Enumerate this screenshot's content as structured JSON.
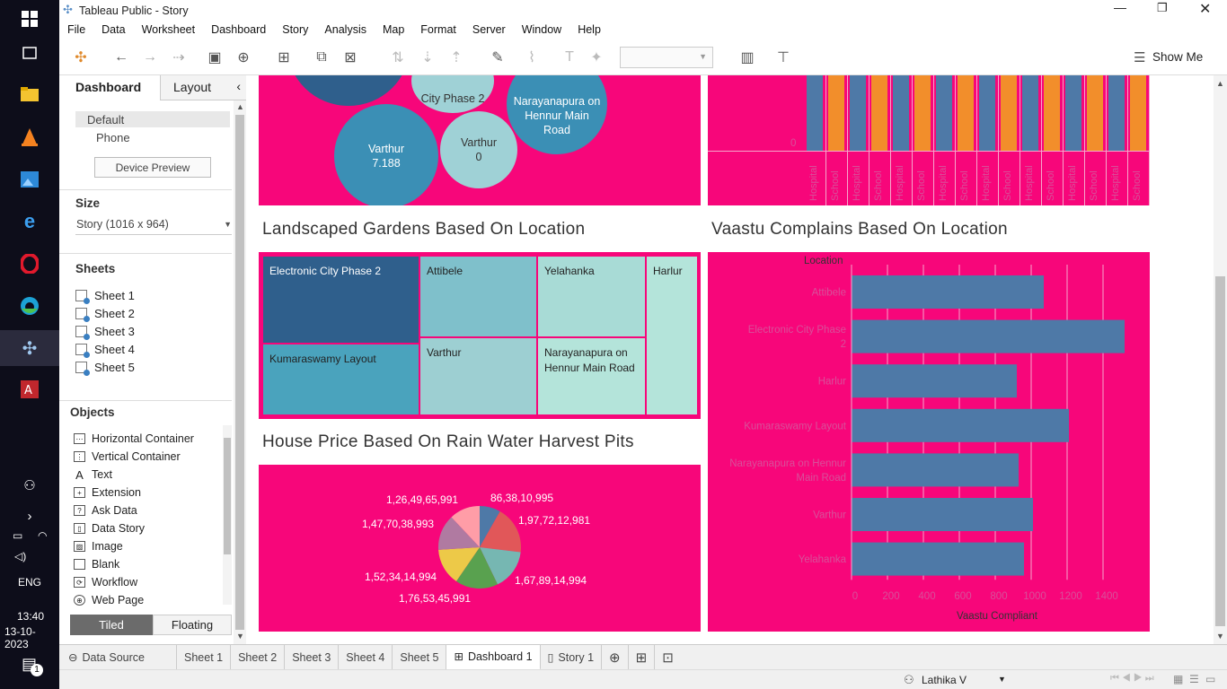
{
  "taskbar": {
    "time": "13:40",
    "date": "13-10-2023",
    "lang": "ENG",
    "notification_count": "1"
  },
  "window": {
    "title": "Tableau Public - Story",
    "icon": "tableau-logo-icon"
  },
  "menu": [
    "File",
    "Data",
    "Worksheet",
    "Dashboard",
    "Story",
    "Analysis",
    "Map",
    "Format",
    "Server",
    "Window",
    "Help"
  ],
  "toolbar": {
    "show_me": "Show Me"
  },
  "left_panel": {
    "tab_dashboard": "Dashboard",
    "tab_layout": "Layout",
    "device_default": "Default",
    "device_phone": "Phone",
    "device_preview": "Device Preview",
    "size_heading": "Size",
    "size_value": "Story (1016 x 964)",
    "sheets_heading": "Sheets",
    "sheets": [
      "Sheet 1",
      "Sheet 2",
      "Sheet 3",
      "Sheet 4",
      "Sheet 5"
    ],
    "objects_heading": "Objects",
    "objects": [
      {
        "label": "Horizontal Container",
        "icon": "horizontal-container-icon"
      },
      {
        "label": "Vertical Container",
        "icon": "vertical-container-icon"
      },
      {
        "label": "Text",
        "icon": "text-icon"
      },
      {
        "label": "Extension",
        "icon": "extension-icon"
      },
      {
        "label": "Ask Data",
        "icon": "ask-data-icon"
      },
      {
        "label": "Data Story",
        "icon": "data-story-icon"
      },
      {
        "label": "Image",
        "icon": "image-icon"
      },
      {
        "label": "Blank",
        "icon": "blank-icon"
      },
      {
        "label": "Workflow",
        "icon": "workflow-icon"
      },
      {
        "label": "Web Page",
        "icon": "web-page-icon"
      }
    ],
    "tiled": "Tiled",
    "floating": "Floating"
  },
  "dashboard": {
    "accent": "#f7067a",
    "bubbles": [
      {
        "label": "City Phase 2",
        "value": ""
      },
      {
        "label": "Narayanapura on Hennur Main Road",
        "value": ""
      },
      {
        "label": "Varthur",
        "value": "7.188"
      },
      {
        "label": "Varthur",
        "value": "0"
      }
    ],
    "top_right": {
      "zero_label": "0",
      "x_labels": [
        "Hospital",
        "School",
        "Hospital",
        "School",
        "Hospital",
        "School",
        "Hospital",
        "School",
        "Hospital",
        "School",
        "Hospital",
        "School",
        "Hospital",
        "School",
        "Hospital",
        "School"
      ]
    },
    "treemap_title": "Landscaped Gardens Based On Location",
    "treemap": [
      "Electronic City Phase 2",
      "Attibele",
      "Yelahanka",
      "Harlur",
      "Kumaraswamy Layout",
      "Varthur",
      "Narayanapura on Hennur Main Road"
    ],
    "pie_title": "House Price Based On Rain Water Harvest Pits",
    "pie_labels": [
      "86,38,10,995",
      "1,97,72,12,981",
      "1,67,89,14,994",
      "1,76,53,45,991",
      "1,52,34,14,994",
      "1,47,70,38,993",
      "1,26,49,65,991"
    ],
    "bar_title": "Vaastu Complains Based On Location"
  },
  "chart_data": [
    {
      "type": "bar",
      "title": "Vaastu Complains Based On Location",
      "orientation": "horizontal",
      "axis_title_rows": "Location",
      "xlabel": "Vaastu Compliant",
      "categories": [
        "Attibele",
        "Electronic City Phase 2",
        "Harlur",
        "Kumaraswamy Layout",
        "Narayanapura on Hennur Main Road",
        "Varthur",
        "Yelahanka"
      ],
      "values": [
        1070,
        1520,
        920,
        1210,
        930,
        1010,
        960
      ],
      "xlim": [
        0,
        1600
      ],
      "xticks": [
        0,
        200,
        400,
        600,
        800,
        1000,
        1200,
        1400
      ],
      "color": "#4e79a7"
    },
    {
      "type": "pie",
      "title": "House Price Based On Rain Water Harvest Pits",
      "labels": [
        "86,38,10,995",
        "1,97,72,12,981",
        "1,67,89,14,994",
        "1,76,53,45,991",
        "1,52,34,14,994",
        "1,47,70,38,993",
        "1,26,49,65,991"
      ],
      "values": [
        863810995,
        1977212981,
        1678914994,
        1765345991,
        1523414994,
        1477038993,
        1264965991
      ],
      "colors": [
        "#4e79a7",
        "#e15759",
        "#76b7b2",
        "#59a14f",
        "#edc948",
        "#b07aa1",
        "#ff9da7"
      ]
    }
  ],
  "bottom_tabs": {
    "data_source": "Data Source",
    "sheets": [
      "Sheet 1",
      "Sheet 2",
      "Sheet 3",
      "Sheet 4",
      "Sheet 5"
    ],
    "dashboard": "Dashboard 1",
    "story": "Story 1"
  },
  "status": {
    "user": "Lathika V"
  }
}
